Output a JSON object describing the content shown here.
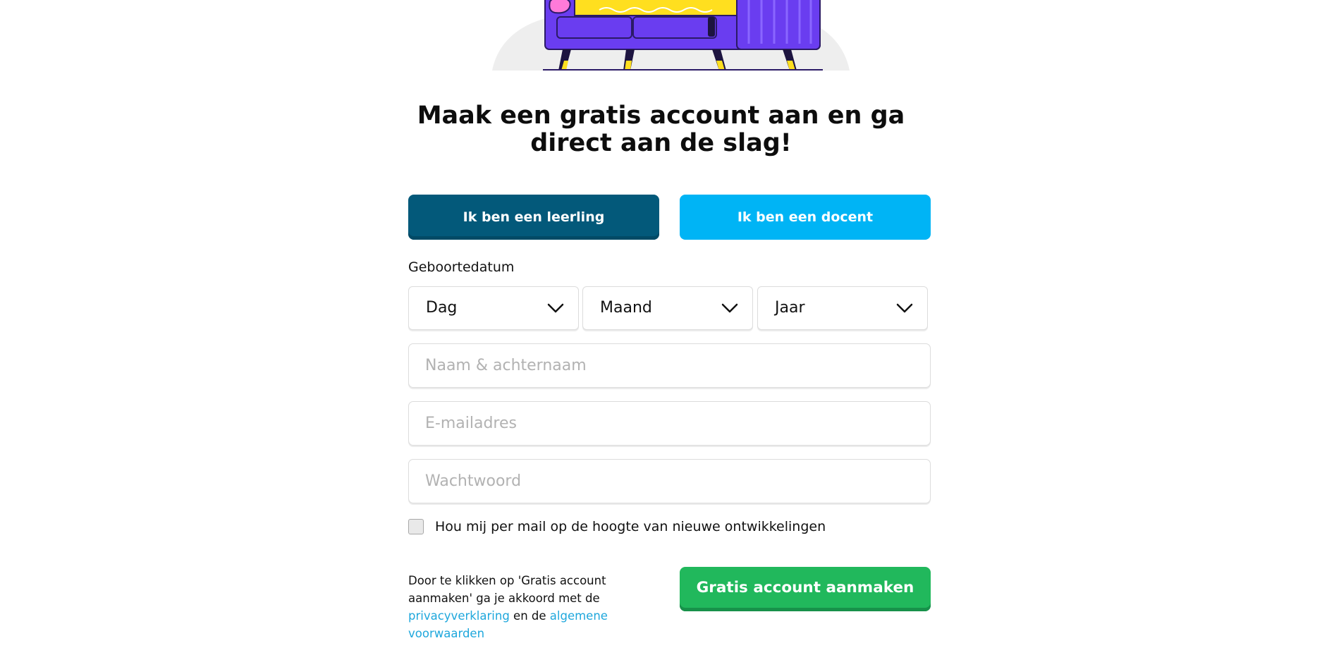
{
  "heading": {
    "line1": "Maak een gratis account aan en ga",
    "line2": "direct aan de slag!"
  },
  "roles": {
    "student_label": "Ik ben een leerling",
    "teacher_label": "Ik ben een docent",
    "selected": "student"
  },
  "birthdate": {
    "label": "Geboortedatum",
    "day": "Dag",
    "month": "Maand",
    "year": "Jaar"
  },
  "fields": {
    "name_placeholder": "Naam & achternaam",
    "email_placeholder": "E-mailadres",
    "password_placeholder": "Wachtwoord"
  },
  "newsletter": {
    "label": "Hou mij per mail op de hoogte van nieuwe ontwikkelingen",
    "checked": false
  },
  "terms": {
    "text_before": "Door te klikken op 'Gratis account aanmaken' ga je akkoord met de ",
    "privacy_link": "privacyverklaring",
    "text_middle": " en de ",
    "conditions_link": "algemene voorwaarden"
  },
  "submit_label": "Gratis account aanmaken",
  "colors": {
    "student_button": "#03597a",
    "teacher_button": "#00b4f5",
    "submit_button": "#21b85c",
    "link": "#1ea7dc"
  },
  "icons": {
    "select_chevron": "chevron-down-icon",
    "illustration": "sofa-illustration"
  }
}
